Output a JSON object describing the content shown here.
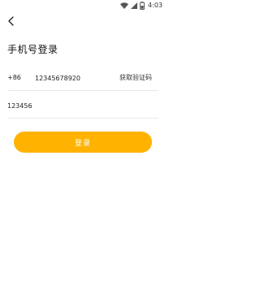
{
  "status_bar": {
    "time": "4:03",
    "icons": [
      "wifi-icon",
      "signal-icon",
      "battery-icon"
    ]
  },
  "header": {
    "back_icon": "chevron-left-icon",
    "title": "手机号登录"
  },
  "form": {
    "country_code": "+86",
    "phone_value": "12345678920",
    "get_code_label": "获取验证码",
    "code_value": "123456"
  },
  "actions": {
    "login_label": "登录"
  },
  "colors": {
    "accent": "#FFB300",
    "divider": "#E8E8E8",
    "text": "#222222"
  }
}
